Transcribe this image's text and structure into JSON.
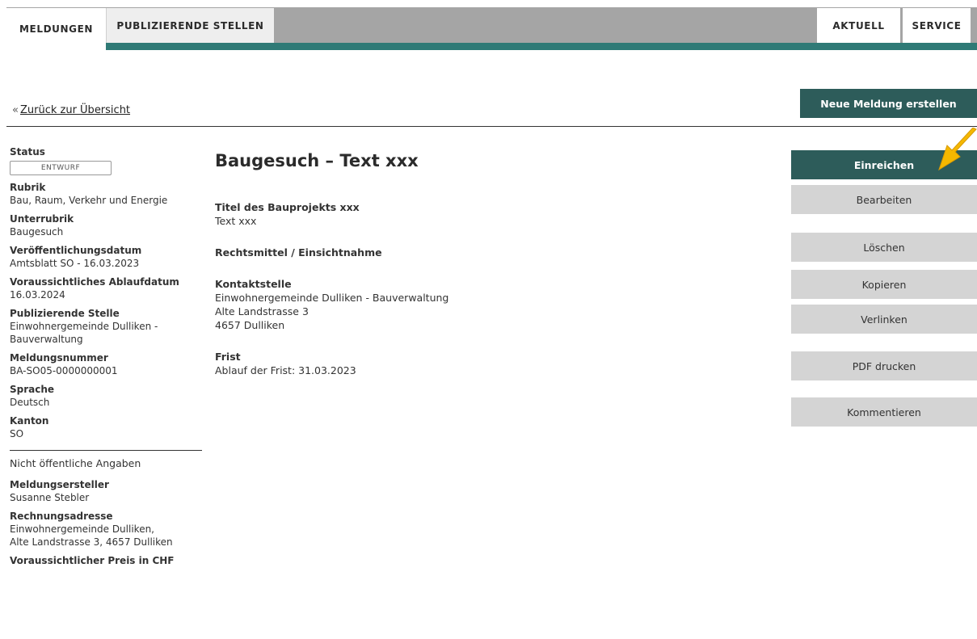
{
  "nav": {
    "tabs_left": [
      "MELDUNGEN",
      "PUBLIZIERENDE STELLEN"
    ],
    "tabs_right": [
      "AKTUELL",
      "SERVICE"
    ]
  },
  "back_link": {
    "arrow": "«",
    "label": "Zurück zur Übersicht"
  },
  "new_button": "Neue Meldung erstellen",
  "sidebar": {
    "status_label": "Status",
    "status_value": "ENTWURF",
    "rubrik_label": "Rubrik",
    "rubrik_value": "Bau, Raum, Verkehr und Energie",
    "unterrubrik_label": "Unterrubrik",
    "unterrubrik_value": "Baugesuch",
    "veroeff_label": "Veröffentlichungsdatum",
    "veroeff_value": "Amtsblatt SO - 16.03.2023",
    "ablauf_label": "Voraussichtliches Ablaufdatum",
    "ablauf_value": "16.03.2024",
    "stelle_label": "Publizierende Stelle",
    "stelle_value_1": "Einwohnergemeinde Dulliken -",
    "stelle_value_2": "Bauverwaltung",
    "nummer_label": "Meldungsnummer",
    "nummer_value": "BA-SO05-0000000001",
    "sprache_label": "Sprache",
    "sprache_value": "Deutsch",
    "kanton_label": "Kanton",
    "kanton_value": "SO",
    "nonpublic_heading": "Nicht öffentliche Angaben",
    "ersteller_label": "Meldungsersteller",
    "ersteller_value": "Susanne Stebler",
    "rechnung_label": "Rechnungsadresse",
    "rechnung_value_1": "Einwohnergemeinde Dulliken,",
    "rechnung_value_2": "Alte Landstrasse 3, 4657 Dulliken",
    "preis_label": "Voraussichtlicher Preis in CHF"
  },
  "main": {
    "title": "Baugesuch – Text xxx",
    "titel_head": "Titel des Bauprojekts xxx",
    "titel_text": "Text xxx",
    "rechtsmittel_head": "Rechtsmittel / Einsichtnahme",
    "kontakt_head": "Kontaktstelle",
    "kontakt_line1": "Einwohnergemeinde Dulliken - Bauverwaltung",
    "kontakt_line2": "Alte Landstrasse 3",
    "kontakt_line3": "4657 Dulliken",
    "frist_head": "Frist",
    "frist_text": "Ablauf der Frist: 31.03.2023"
  },
  "actions": {
    "einreichen": "Einreichen",
    "bearbeiten": "Bearbeiten",
    "loeschen": "Löschen",
    "kopieren": "Kopieren",
    "verlinken": "Verlinken",
    "pdf": "PDF drucken",
    "kommentieren": "Kommentieren"
  },
  "colors": {
    "brand_teal": "#2d5c5a",
    "nav_grey": "#a5a5a5",
    "button_grey": "#d4d4d4",
    "hint_arrow": "#f5b800"
  }
}
